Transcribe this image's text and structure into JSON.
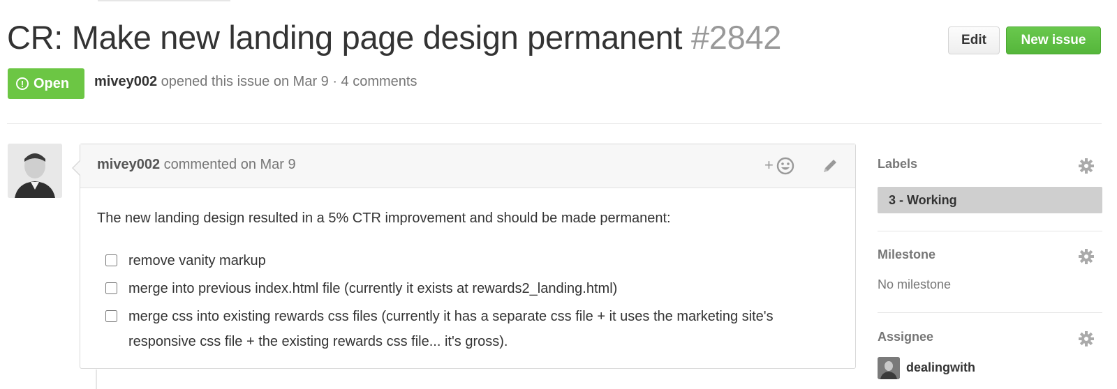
{
  "issue": {
    "title": "CR: Make new landing page design permanent",
    "number": "#2842",
    "state": "Open",
    "author": "mivey002",
    "opened_text": "opened this issue on Mar 9 · 4 comments"
  },
  "header_buttons": {
    "edit_label": "Edit",
    "new_issue_label": "New issue"
  },
  "comment": {
    "author": "mivey002",
    "action_text": "commented on Mar 9",
    "reaction_icon": "add-reaction-icon",
    "edit_icon": "pencil-icon",
    "body_text": "The new landing design resulted in a 5% CTR improvement and should be made permanent:",
    "tasks": [
      {
        "text": "remove vanity markup",
        "checked": false
      },
      {
        "text": "merge into previous index.html file (currently it exists at rewards2_landing.html)",
        "checked": false
      },
      {
        "text": "merge css into existing rewards css files (currently it has a separate css file + it uses the marketing site's responsive css file + the existing rewards css file... it's gross).",
        "checked": false
      }
    ]
  },
  "sidebar": {
    "labels": {
      "heading": "Labels",
      "items": [
        "3 - Working"
      ]
    },
    "milestone": {
      "heading": "Milestone",
      "value": "No milestone"
    },
    "assignee": {
      "heading": "Assignee",
      "name": "dealingwith"
    }
  },
  "colors": {
    "open_green": "#6cc644",
    "new_issue_green": "#5bbd41",
    "label_gray": "#cfcfcf",
    "muted_text": "#767676"
  }
}
